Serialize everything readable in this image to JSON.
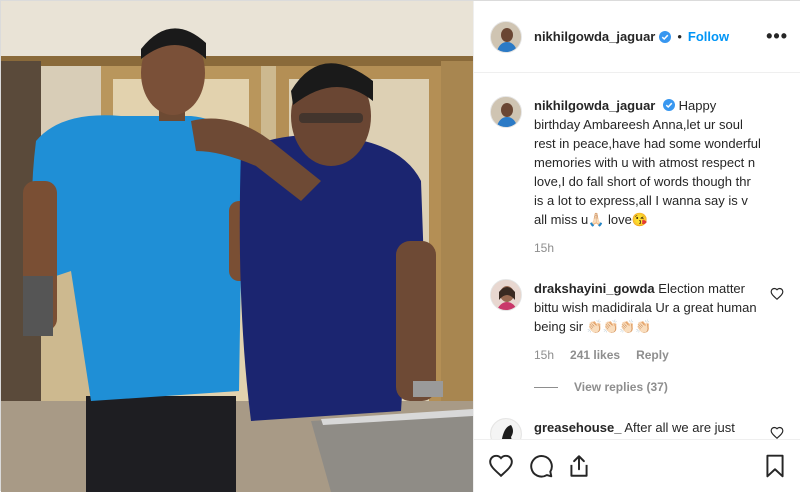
{
  "post": {
    "username": "nikhilgowda_jaguar",
    "follow_label": "Follow",
    "more_label": "•••",
    "separator": "•"
  },
  "caption": {
    "username": "nikhilgowda_jaguar",
    "text": "Happy birthday Ambareesh Anna,let ur soul rest in peace,have had some wonderful memories with u with atmost respect n love,I do fall short of words though thr is a lot to express,all I wanna say is v all miss u🙏🏻 love😘",
    "time": "15h"
  },
  "comments": [
    {
      "username": "drakshayini_gowda",
      "text": "Election matter bittu wish madidirala Ur a great human being sir 👏🏻👏🏻👏🏻👏🏻",
      "time": "15h",
      "likes": "241 likes",
      "reply_label": "Reply",
      "view_replies": "View replies (37)"
    },
    {
      "username": "greasehouse_",
      "text": "After all we are just human, hats off Nikhil sir being"
    }
  ],
  "icons": {
    "like": "heart-icon",
    "comment": "comment-icon",
    "share": "share-icon",
    "save": "bookmark-icon",
    "verified": "verified-badge-icon",
    "comment_like": "heart-icon"
  },
  "colors": {
    "accent": "#0095f6",
    "text": "#262626",
    "muted": "#8e8e8e"
  }
}
